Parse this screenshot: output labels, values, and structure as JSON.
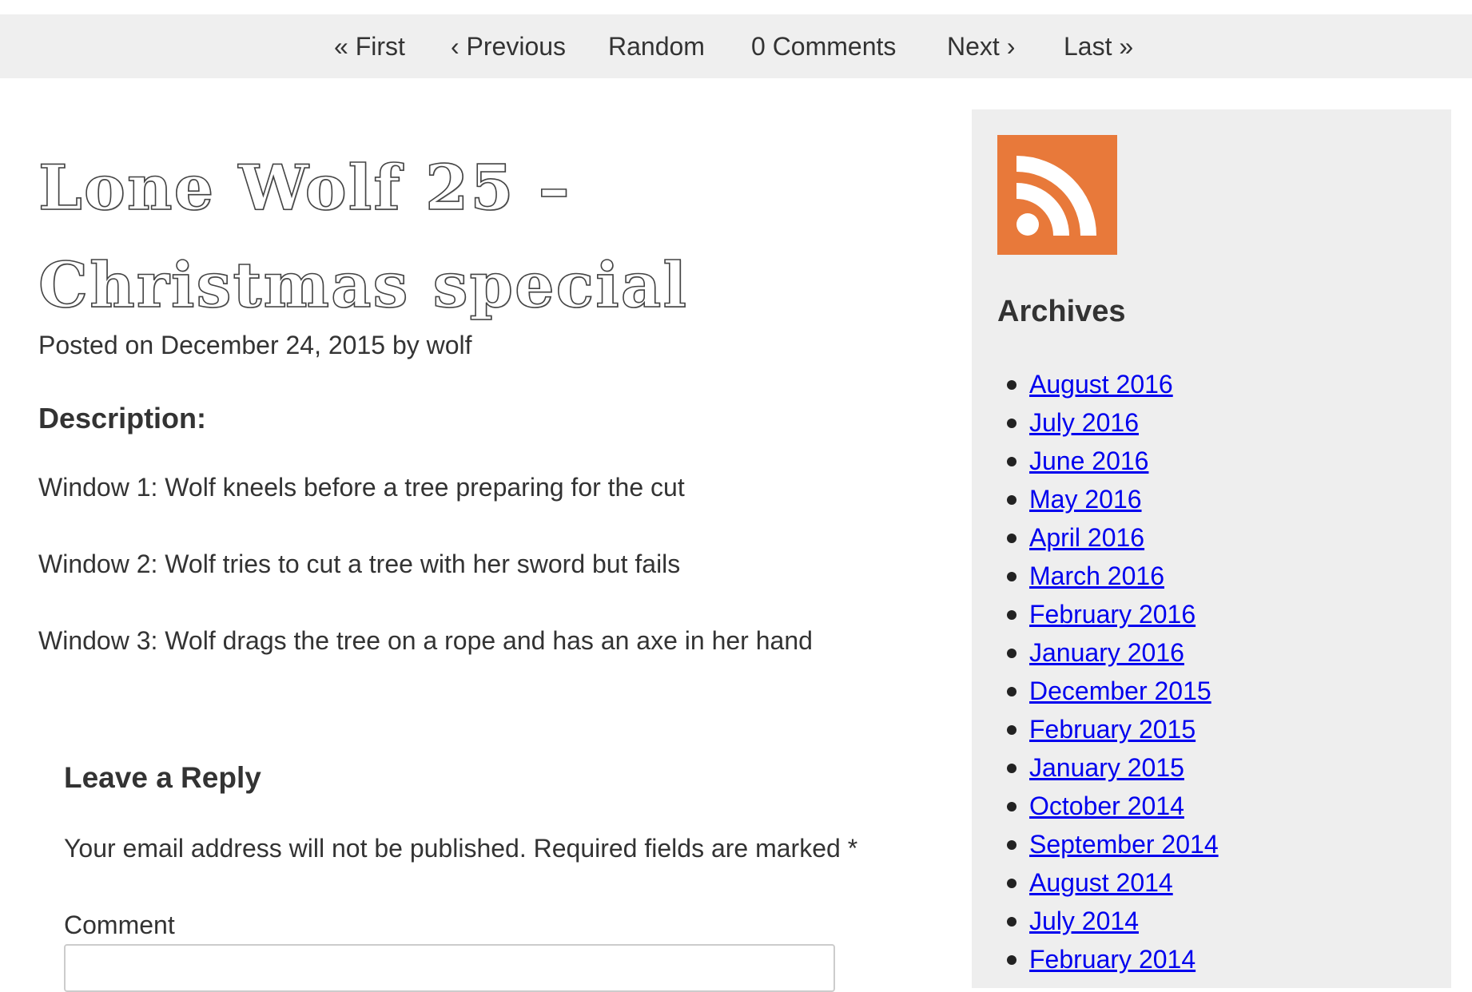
{
  "nav": {
    "first": "« First",
    "previous": "‹ Previous",
    "random": "Random",
    "comments": "0 Comments",
    "next": "Next ›",
    "last": "Last »"
  },
  "post": {
    "title": "Lone Wolf 25 – Christmas special",
    "posted_prefix": "Posted on ",
    "date": "December 24, 2015",
    "by": " by ",
    "author": "wolf",
    "description_heading": "Description:",
    "description_lines": [
      "Window 1: Wolf kneels before a tree preparing for the cut",
      "Window 2: Wolf tries to cut a tree with her sword but fails",
      "Window 3: Wolf drags the tree on a rope and has an axe in her hand"
    ]
  },
  "reply": {
    "heading": "Leave a Reply",
    "notice": "Your email address will not be published. Required fields are marked *",
    "comment_label": "Comment"
  },
  "sidebar": {
    "rss_icon": "rss-feed-icon",
    "rss_color": "#e8793a",
    "archives_heading": "Archives",
    "archives": [
      "August 2016",
      "July 2016",
      "June 2016",
      "May 2016",
      "April 2016",
      "March 2016",
      "February 2016",
      "January 2016",
      "December 2015",
      "February 2015",
      "January 2015",
      "October 2014",
      "September 2014",
      "August 2014",
      "July 2014",
      "February 2014"
    ]
  }
}
